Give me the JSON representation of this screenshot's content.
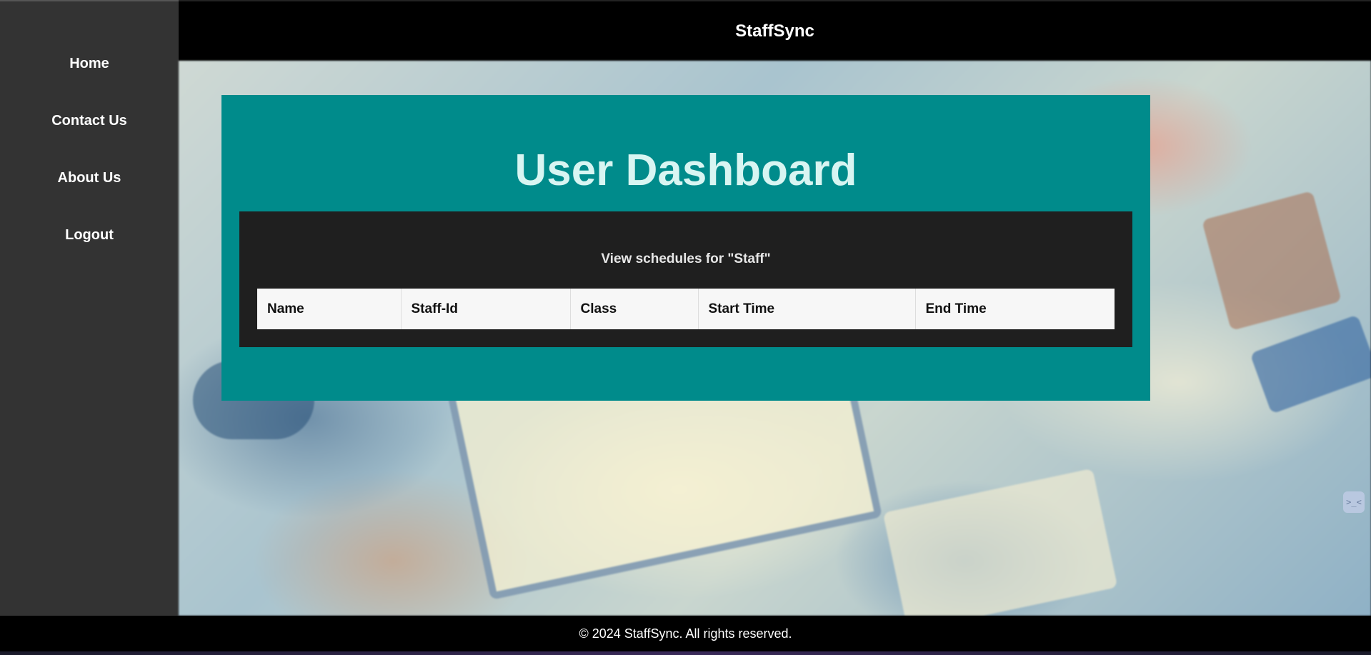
{
  "app": {
    "title": "StaffSync"
  },
  "sidebar": {
    "items": [
      {
        "label": "Home"
      },
      {
        "label": "Contact Us"
      },
      {
        "label": "About Us"
      },
      {
        "label": "Logout"
      }
    ]
  },
  "dashboard": {
    "title": "User Dashboard",
    "subtitle": "View schedules for \"Staff\"",
    "table": {
      "columns": [
        "Name",
        "Staff-Id",
        "Class",
        "Start Time",
        "End Time"
      ],
      "rows": []
    }
  },
  "footer": {
    "text": "© 2024 StaffSync. All rights reserved."
  },
  "colors": {
    "sidebar": "#333333",
    "header": "#000000",
    "panel": "#008b8b",
    "inner_panel": "#1f1f1f",
    "title_text": "#d8f5f2"
  },
  "widget": {
    "icon": "chat-bubble-icon",
    "glyph": ">_<"
  }
}
